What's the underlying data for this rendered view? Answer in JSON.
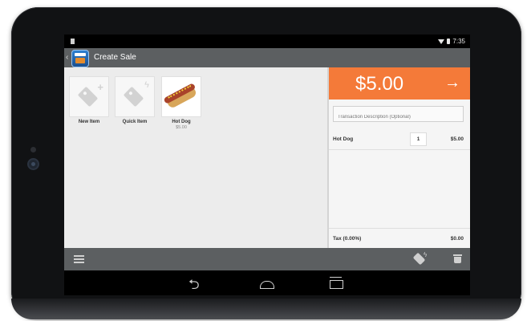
{
  "status_bar": {
    "time": "7:35"
  },
  "action_bar": {
    "title": "Create Sale"
  },
  "items": [
    {
      "label": "New Item",
      "price": "",
      "icon": "tag-plus-icon"
    },
    {
      "label": "Quick Item",
      "price": "",
      "icon": "tag-bolt-icon"
    },
    {
      "label": "Hot Dog",
      "price": "$5.00",
      "icon": "hot-dog-image"
    }
  ],
  "cart": {
    "total": "$5.00",
    "description_placeholder": "Transaction Description (Optional)",
    "lines": [
      {
        "name": "Hot Dog",
        "quantity": "1",
        "price": "$5.00"
      }
    ],
    "tax_label": "Tax (0.00%)",
    "tax_value": "$0.00"
  },
  "colors": {
    "accent": "#f47a39",
    "action_bar": "#5c5f61",
    "background": "#ebebeb"
  },
  "icons": {
    "menu": "menu-icon",
    "discount": "discount-tag-icon",
    "delete": "trash-icon",
    "charge": "arrow-right-icon",
    "nav_back": "nav-back-icon",
    "nav_home": "nav-home-icon",
    "nav_recents": "nav-recents-icon"
  }
}
